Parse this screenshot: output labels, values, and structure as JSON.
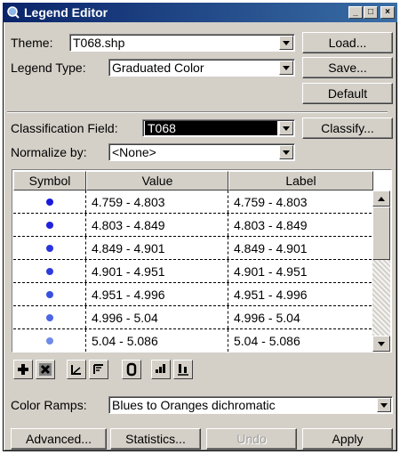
{
  "window": {
    "title": "Legend Editor",
    "controls": {
      "minimize": "_",
      "maximize": "□",
      "close": "×"
    }
  },
  "theme": {
    "label": "Theme:",
    "value": "T068.shp"
  },
  "legend_type": {
    "label": "Legend Type:",
    "value": "Graduated Color"
  },
  "buttons": {
    "load": "Load...",
    "save": "Save...",
    "default": "Default",
    "classify": "Classify..."
  },
  "classification": {
    "label": "Classification Field:",
    "value": "T068"
  },
  "normalize": {
    "label": "Normalize by:",
    "value": "<None>"
  },
  "table": {
    "columns": [
      "Symbol",
      "Value",
      "Label"
    ],
    "rows": [
      {
        "color": "#1a1adc",
        "value": "4.759 - 4.803",
        "label": "4.759 - 4.803"
      },
      {
        "color": "#1e22dc",
        "value": "4.803 - 4.849",
        "label": "4.803 - 4.849"
      },
      {
        "color": "#2a34dc",
        "value": "4.849 - 4.901",
        "label": "4.849 - 4.901"
      },
      {
        "color": "#2e3cdc",
        "value": "4.901 - 4.951",
        "label": "4.901 - 4.951"
      },
      {
        "color": "#3850e0",
        "value": "4.951 - 4.996",
        "label": "4.951 - 4.996"
      },
      {
        "color": "#4c66e4",
        "value": "4.996 - 5.04",
        "label": "4.996 - 5.04"
      },
      {
        "color": "#6e8aea",
        "value": "5.04 - 5.086",
        "label": "5.04 - 5.086"
      }
    ]
  },
  "toolbar": {
    "icons": [
      "add-icon",
      "delete-icon",
      "sort-ascending-icon",
      "sort-descending-icon",
      "null-value-icon",
      "reverse-icon",
      "flip-icon"
    ]
  },
  "color_ramps": {
    "label": "Color Ramps:",
    "value": "Blues to Oranges dichromatic"
  },
  "footer": {
    "advanced": "Advanced...",
    "statistics": "Statistics...",
    "undo": "Undo",
    "apply": "Apply"
  }
}
